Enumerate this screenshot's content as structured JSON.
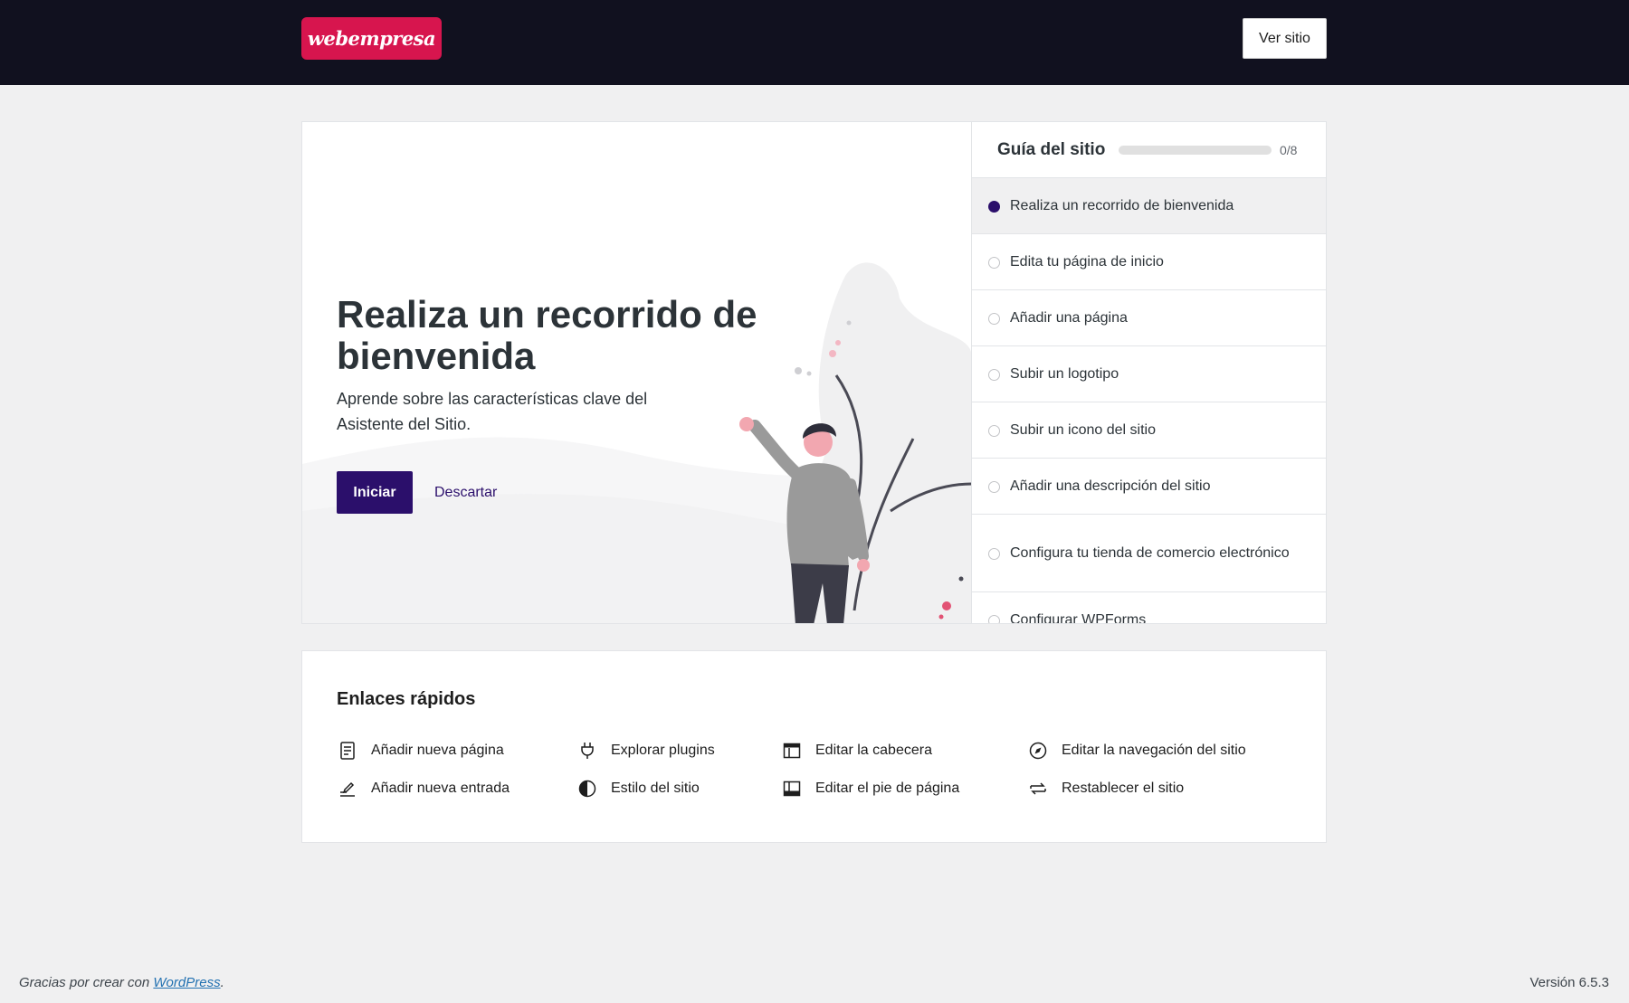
{
  "header": {
    "logo_text": "webempresa",
    "view_site_label": "Ver sitio",
    "brand_color": "#d7154e",
    "bar_color": "#11111f"
  },
  "hero": {
    "title": "Realiza un recorrido de bienvenida",
    "description": "Aprende sobre las características clave del Asistente del Sitio.",
    "start_label": "Iniciar",
    "dismiss_label": "Descartar",
    "accent_color": "#2b0f6b"
  },
  "guide": {
    "title": "Guía del sitio",
    "progress_text": "0/8",
    "progress_fraction": 0,
    "items": [
      {
        "label": "Realiza un recorrido de bienvenida"
      },
      {
        "label": "Edita tu página de inicio"
      },
      {
        "label": "Añadir una página"
      },
      {
        "label": "Subir un logotipo"
      },
      {
        "label": "Subir un icono del sitio"
      },
      {
        "label": "Añadir una descripción del sitio"
      },
      {
        "label": "Configura tu tienda de comercio electrónico"
      },
      {
        "label": "Configurar WPForms"
      }
    ]
  },
  "quick_links": {
    "title": "Enlaces rápidos",
    "items": [
      {
        "label": "Añadir nueva página",
        "icon": "page-icon"
      },
      {
        "label": "Añadir nueva entrada",
        "icon": "post-icon"
      },
      {
        "label": "Explorar plugins",
        "icon": "plugin-icon"
      },
      {
        "label": "Estilo del sitio",
        "icon": "style-icon"
      },
      {
        "label": "Editar la cabecera",
        "icon": "header-icon"
      },
      {
        "label": "Editar el pie de página",
        "icon": "footer-icon"
      },
      {
        "label": "Editar la navegación del sitio",
        "icon": "navigation-icon"
      },
      {
        "label": "Restablecer el sitio",
        "icon": "reset-icon"
      }
    ]
  },
  "footer": {
    "thanks_prefix": "Gracias por crear con ",
    "thanks_link": "WordPress",
    "thanks_suffix": ".",
    "version": "Versión 6.5.3"
  }
}
